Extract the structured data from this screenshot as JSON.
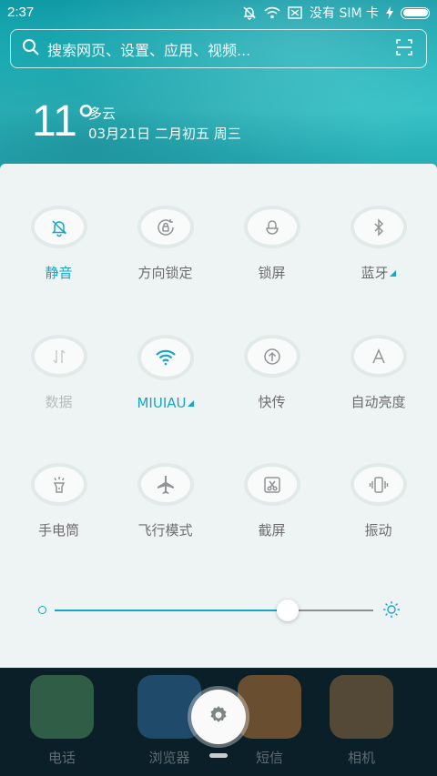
{
  "status_bar": {
    "time": "2:37",
    "carrier": "没有 SIM 卡"
  },
  "search": {
    "placeholder": "搜索网页、设置、应用、视频..."
  },
  "weather": {
    "temperature": "11°",
    "condition": "多云",
    "date": "03月21日 二月初五 周三"
  },
  "toggles": [
    {
      "label": "静音",
      "icon": "bell-off-icon",
      "state": "active",
      "has_menu": false
    },
    {
      "label": "方向锁定",
      "icon": "rotation-lock-icon",
      "state": "normal",
      "has_menu": false
    },
    {
      "label": "锁屏",
      "icon": "lock-icon",
      "state": "normal",
      "has_menu": false
    },
    {
      "label": "蓝牙",
      "icon": "bluetooth-icon",
      "state": "normal",
      "has_menu": true
    },
    {
      "label": "数据",
      "icon": "data-arrows-icon",
      "state": "disabled",
      "has_menu": false
    },
    {
      "label": "MIUIAU",
      "icon": "wifi-icon",
      "state": "active",
      "has_menu": true
    },
    {
      "label": "快传",
      "icon": "quick-transfer-icon",
      "state": "normal",
      "has_menu": false
    },
    {
      "label": "自动亮度",
      "icon": "auto-brightness-icon",
      "state": "normal",
      "has_menu": false
    },
    {
      "label": "手电筒",
      "icon": "flashlight-icon",
      "state": "normal",
      "has_menu": false
    },
    {
      "label": "飞行模式",
      "icon": "airplane-icon",
      "state": "normal",
      "has_menu": false
    },
    {
      "label": "截屏",
      "icon": "screenshot-icon",
      "state": "normal",
      "has_menu": false
    },
    {
      "label": "振动",
      "icon": "vibrate-icon",
      "state": "normal",
      "has_menu": false
    }
  ],
  "brightness": {
    "level": 0.73
  },
  "dock": {
    "apps": [
      {
        "label": "电话",
        "icon": "phone-icon",
        "color": "#5fa86b"
      },
      {
        "label": "浏览器",
        "icon": "browser-icon",
        "color": "#3a7fb8"
      },
      {
        "label": "短信",
        "icon": "messages-icon",
        "color": "#e0883a"
      },
      {
        "label": "相机",
        "icon": "camera-icon",
        "color": "#b07a4a"
      }
    ]
  },
  "colors": {
    "accent": "#16a7c4",
    "panel_bg": "#eef3f3"
  }
}
